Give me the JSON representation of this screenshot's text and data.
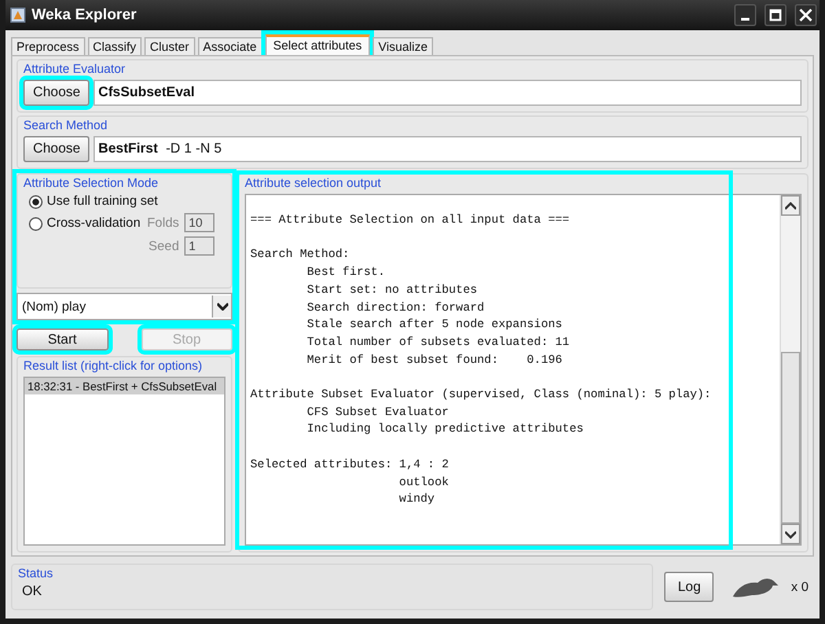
{
  "window": {
    "title": "Weka Explorer"
  },
  "tabs": [
    {
      "label": "Preprocess",
      "selected": false,
      "highlighted": false
    },
    {
      "label": "Classify",
      "selected": false,
      "highlighted": false
    },
    {
      "label": "Cluster",
      "selected": false,
      "highlighted": false
    },
    {
      "label": "Associate",
      "selected": false,
      "highlighted": false
    },
    {
      "label": "Select attributes",
      "selected": true,
      "highlighted": true
    },
    {
      "label": "Visualize",
      "selected": false,
      "highlighted": false
    }
  ],
  "evaluator": {
    "title": "Attribute Evaluator",
    "button": {
      "label": "Choose",
      "highlighted": true
    },
    "value": "CfsSubsetEval"
  },
  "search": {
    "title": "Search Method",
    "button": {
      "label": "Choose",
      "highlighted": false
    },
    "value": "BestFirst",
    "options": "-D 1 -N 5"
  },
  "mode": {
    "title": "Attribute Selection Mode",
    "highlighted": true,
    "options": [
      {
        "label": "Use full training set",
        "selected": true
      },
      {
        "label": "Cross-validation",
        "selected": false
      }
    ],
    "fields": [
      {
        "label": "Folds",
        "value": "10",
        "disabled": true
      },
      {
        "label": "Seed",
        "value": "1",
        "disabled": true
      }
    ],
    "class_select": "(Nom) play"
  },
  "actions": [
    {
      "label": "Start",
      "disabled": false,
      "highlighted": true
    },
    {
      "label": "Stop",
      "disabled": true,
      "highlighted": true
    }
  ],
  "result_list": {
    "title": "Result list (right-click for options)",
    "items": [
      {
        "label": "18:32:31 - BestFirst + CfsSubsetEval",
        "selected": true
      }
    ]
  },
  "output": {
    "title": "Attribute selection output",
    "highlighted": true,
    "text": "=== Attribute Selection on all input data ===\n\nSearch Method:\n        Best first.\n        Start set: no attributes\n        Search direction: forward\n        Stale search after 5 node expansions\n        Total number of subsets evaluated: 11\n        Merit of best subset found:    0.196\n\nAttribute Subset Evaluator (supervised, Class (nominal): 5 play):\n        CFS Subset Evaluator\n        Including locally predictive attributes\n\nSelected attributes: 1,4 : 2\n                     outlook\n                     windy"
  },
  "status": {
    "title": "Status",
    "message": "OK"
  },
  "log_button": "Log",
  "task_count": "x 0"
}
